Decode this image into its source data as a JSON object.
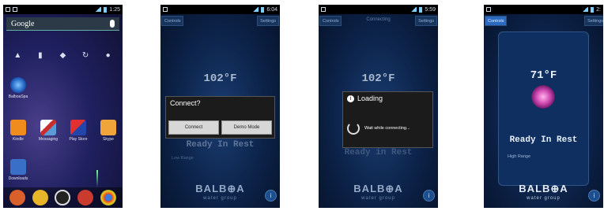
{
  "screens": [
    {
      "status": {
        "left": "",
        "time": "1:25"
      },
      "google": {
        "label": "Google"
      },
      "apps": [
        {
          "label": "BalboaSpa"
        },
        {
          "label": "Kindle"
        },
        {
          "label": "Messaging"
        },
        {
          "label": "Play Store"
        },
        {
          "label": "Skype"
        },
        {
          "label": "Downloads"
        }
      ]
    },
    {
      "status": {
        "time": "6:04"
      },
      "top_left": "Controls",
      "top_right": "Settings",
      "temp": "102°F",
      "state": "Ready In Rest",
      "range": "Low Range",
      "dialog": {
        "title": "Connect?",
        "connect": "Connect",
        "demo": "Demo Mode"
      },
      "logo": "BALB⊕A",
      "logo_sub": "water group"
    },
    {
      "status": {
        "time": "5:59"
      },
      "top_left": "Controls",
      "top_center": "Connecting",
      "top_right": "Settings",
      "temp": "102°F",
      "state": "Ready in Rest",
      "dialog": {
        "title": "Loading",
        "message": "Wait while connecting..."
      },
      "logo": "BALB⊕A",
      "logo_sub": "water group"
    },
    {
      "status": {
        "time": "2:"
      },
      "top_left": "Controls",
      "top_right": "Settings",
      "temp": "71°F",
      "state": "Ready In Rest",
      "range": "High Range",
      "logo": "BALB⊕A",
      "logo_sub": "water group"
    }
  ]
}
